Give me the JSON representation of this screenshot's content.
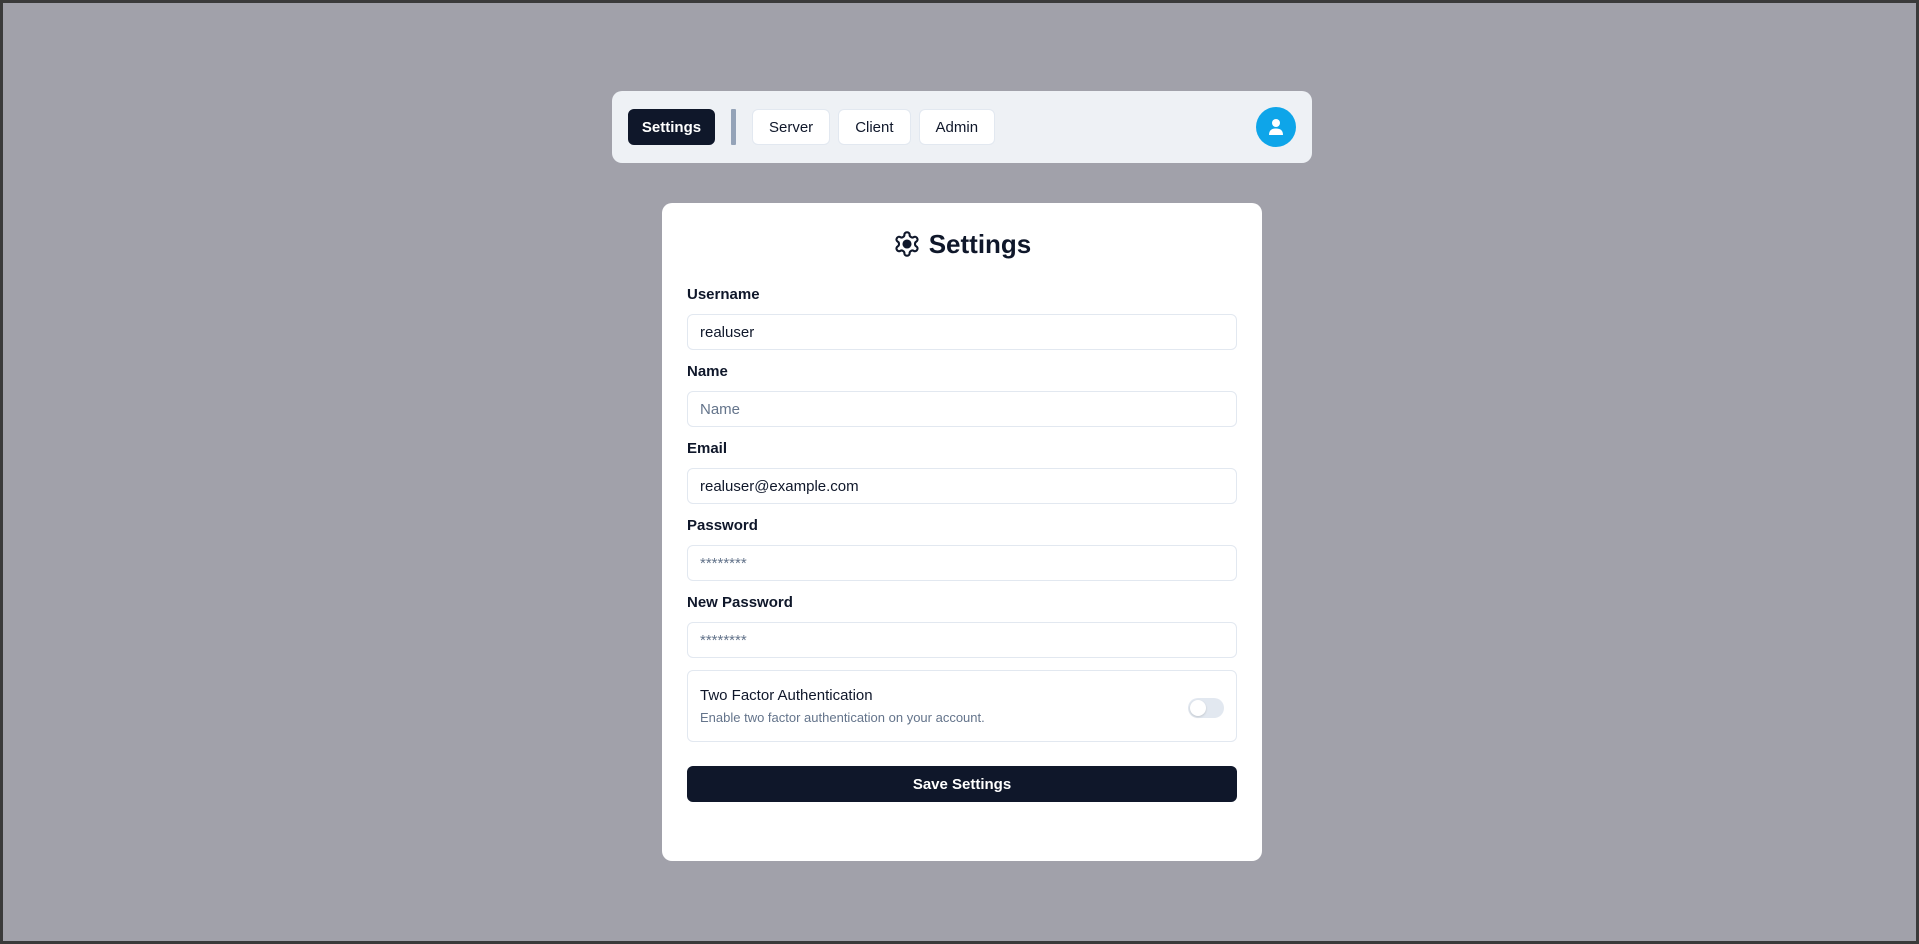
{
  "nav": {
    "tabs": [
      {
        "label": "Settings",
        "active": true
      },
      {
        "label": "Server",
        "active": false
      },
      {
        "label": "Client",
        "active": false
      },
      {
        "label": "Admin",
        "active": false
      }
    ],
    "avatar_icon": "user-icon"
  },
  "card": {
    "title": "Settings",
    "title_icon": "gear-icon",
    "fields": {
      "username": {
        "label": "Username",
        "value": "realuser",
        "placeholder": ""
      },
      "name": {
        "label": "Name",
        "value": "",
        "placeholder": "Name"
      },
      "email": {
        "label": "Email",
        "value": "realuser@example.com",
        "placeholder": ""
      },
      "password": {
        "label": "Password",
        "value": "",
        "placeholder": "********"
      },
      "new_password": {
        "label": "New Password",
        "value": "",
        "placeholder": "********"
      }
    },
    "two_factor": {
      "title": "Two Factor Authentication",
      "description": "Enable two factor authentication on your account.",
      "enabled": false
    },
    "save_label": "Save Settings"
  },
  "colors": {
    "backdrop": "#a1a1aa",
    "primary": "#0f172a",
    "avatar": "#0ea5e9",
    "navbar_bg": "#eef1f5"
  }
}
